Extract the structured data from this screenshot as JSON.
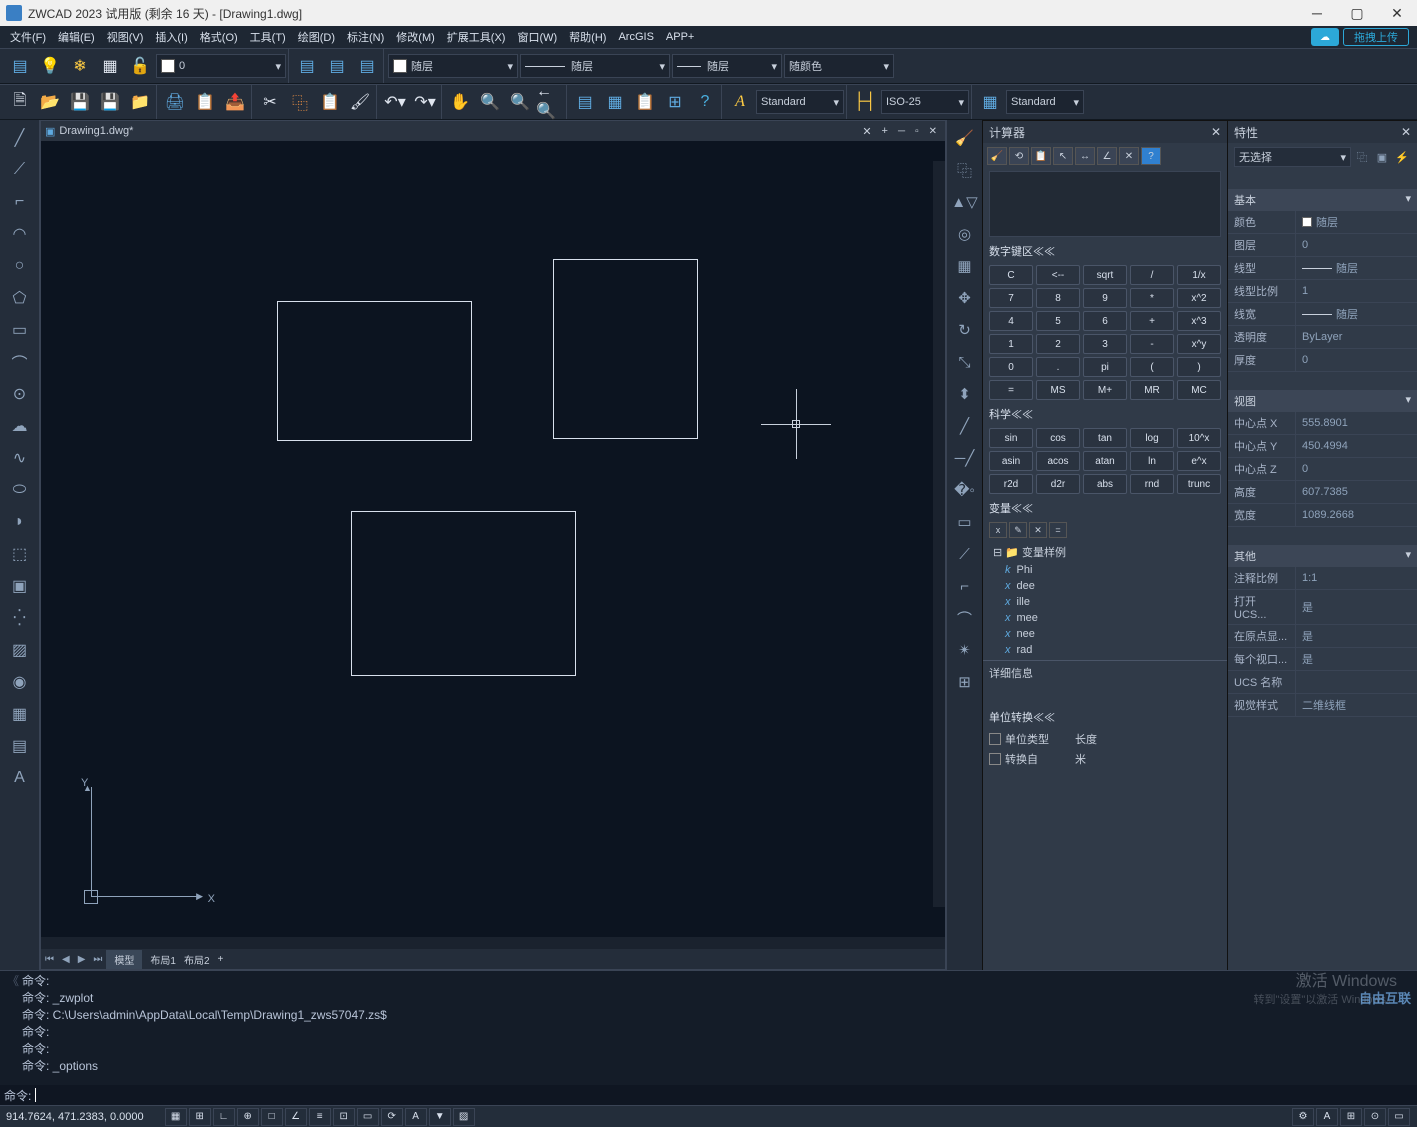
{
  "title": "ZWCAD 2023 试用版 (剩余 16 天) - [Drawing1.dwg]",
  "menu": [
    "文件(F)",
    "编辑(E)",
    "视图(V)",
    "插入(I)",
    "格式(O)",
    "工具(T)",
    "绘图(D)",
    "标注(N)",
    "修改(M)",
    "扩展工具(X)",
    "窗口(W)",
    "帮助(H)",
    "ArcGIS",
    "APP+"
  ],
  "upload_btn": "拖拽上传",
  "layer_dd": "0",
  "linetype_dd": "随层",
  "lineweight_dd": "随层",
  "plotstyle_dd": "随层",
  "color_dd": "随颜色",
  "textstyle_dd": "Standard",
  "dimstyle_dd": "ISO-25",
  "tablestyle_dd": "Standard",
  "draw_tab": "Drawing1.dwg*",
  "layout_tabs": {
    "active": "模型",
    "others": [
      "布局1",
      "布局2"
    ]
  },
  "calc": {
    "title": "计算器",
    "num_section": "数字键区≪≪",
    "keys": [
      [
        "C",
        "<--",
        "sqrt",
        "/",
        "1/x"
      ],
      [
        "7",
        "8",
        "9",
        "*",
        "x^2"
      ],
      [
        "4",
        "5",
        "6",
        "+",
        "x^3"
      ],
      [
        "1",
        "2",
        "3",
        "-",
        "x^y"
      ],
      [
        "0",
        ".",
        "pi",
        "(",
        ")"
      ],
      [
        "=",
        "MS",
        "M+",
        "MR",
        "MC"
      ]
    ],
    "sci_section": "科学≪≪",
    "sci_keys": [
      [
        "sin",
        "cos",
        "tan",
        "log",
        "10^x"
      ],
      [
        "asin",
        "acos",
        "atan",
        "ln",
        "e^x"
      ],
      [
        "r2d",
        "d2r",
        "abs",
        "rnd",
        "trunc"
      ]
    ],
    "var_section": "变量≪≪",
    "var_folder": "变量样例",
    "vars": [
      "Phi",
      "dee",
      "ille",
      "mee",
      "nee",
      "rad"
    ],
    "detail": "详细信息",
    "unit_section": "单位转换≪≪",
    "unit_type_label": "单位类型",
    "unit_type_value": "长度",
    "convert_from_label": "转换自",
    "convert_from_value": "米"
  },
  "props": {
    "title": "特性",
    "selection": "无选择",
    "groups": {
      "basic": {
        "head": "基本",
        "rows": [
          {
            "k": "颜色",
            "v": "随层",
            "sw": true
          },
          {
            "k": "图层",
            "v": "0"
          },
          {
            "k": "线型",
            "v": "随层",
            "ln": true
          },
          {
            "k": "线型比例",
            "v": "1"
          },
          {
            "k": "线宽",
            "v": "随层",
            "ln": true
          },
          {
            "k": "透明度",
            "v": "ByLayer"
          },
          {
            "k": "厚度",
            "v": "0"
          }
        ]
      },
      "view": {
        "head": "视图",
        "rows": [
          {
            "k": "中心点 X",
            "v": "555.8901"
          },
          {
            "k": "中心点 Y",
            "v": "450.4994"
          },
          {
            "k": "中心点 Z",
            "v": "0"
          },
          {
            "k": "高度",
            "v": "607.7385"
          },
          {
            "k": "宽度",
            "v": "1089.2668"
          }
        ]
      },
      "other": {
        "head": "其他",
        "rows": [
          {
            "k": "注释比例",
            "v": "1:1"
          },
          {
            "k": "打开 UCS...",
            "v": "是"
          },
          {
            "k": "在原点显...",
            "v": "是"
          },
          {
            "k": "每个视口...",
            "v": "是"
          },
          {
            "k": "UCS 名称",
            "v": ""
          },
          {
            "k": "视觉样式",
            "v": "二维线框"
          }
        ]
      }
    }
  },
  "cmd": {
    "lines": [
      "命令:",
      "命令:  _zwplot",
      "命令:  C:\\Users\\admin\\AppData\\Local\\Temp\\Drawing1_zws57047.zs$",
      "命令:",
      "命令:",
      "命令:  _options"
    ],
    "prompt": "命令:"
  },
  "status": {
    "coords": "914.7624, 471.2383, 0.0000"
  },
  "watermark1": "激活 Windows",
  "watermark2": "转到\"设置\"以激活 Windows。",
  "watermark3": "自由互联"
}
